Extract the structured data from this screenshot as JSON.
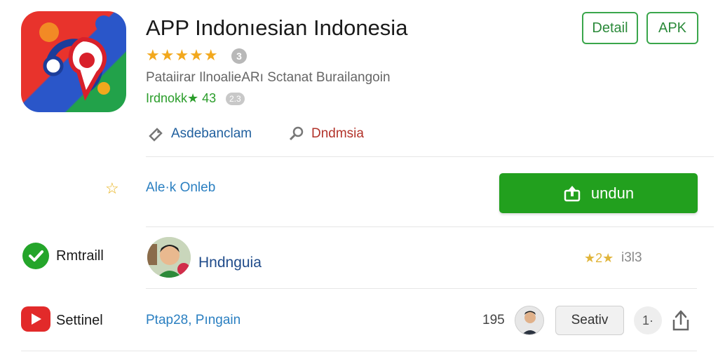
{
  "app": {
    "title": "APP Indonıesian Indonesia",
    "stars": "★★★★★",
    "info_badge": "3",
    "subtitle": "Pataiirar IlnoalieARı Sctanat Burailangoin",
    "rating_line": "Irdnokk★ 43",
    "rating_badge": "2.3"
  },
  "header_buttons": {
    "detail": "Detail",
    "apk": "APK"
  },
  "meta": {
    "tag1": "Asdebanclam",
    "tag2": "Dndmsia"
  },
  "promo": {
    "icon": "☆",
    "text": "Ale·k Onleb"
  },
  "download": {
    "label": "undun"
  },
  "rows": {
    "row1_label": "Rmtraill",
    "row2_label": "Settinel"
  },
  "developer": {
    "name": "Hndnguia",
    "stars": "★2★",
    "review_count": "i3l3"
  },
  "footer": {
    "date": "Ptap28, Pıngain",
    "count": "195",
    "save_label": "Seativ",
    "round_label": "1·"
  },
  "colors": {
    "accent_green": "#22a01e",
    "link_blue": "#2a7fc1",
    "star_gold": "#f2a81d"
  }
}
